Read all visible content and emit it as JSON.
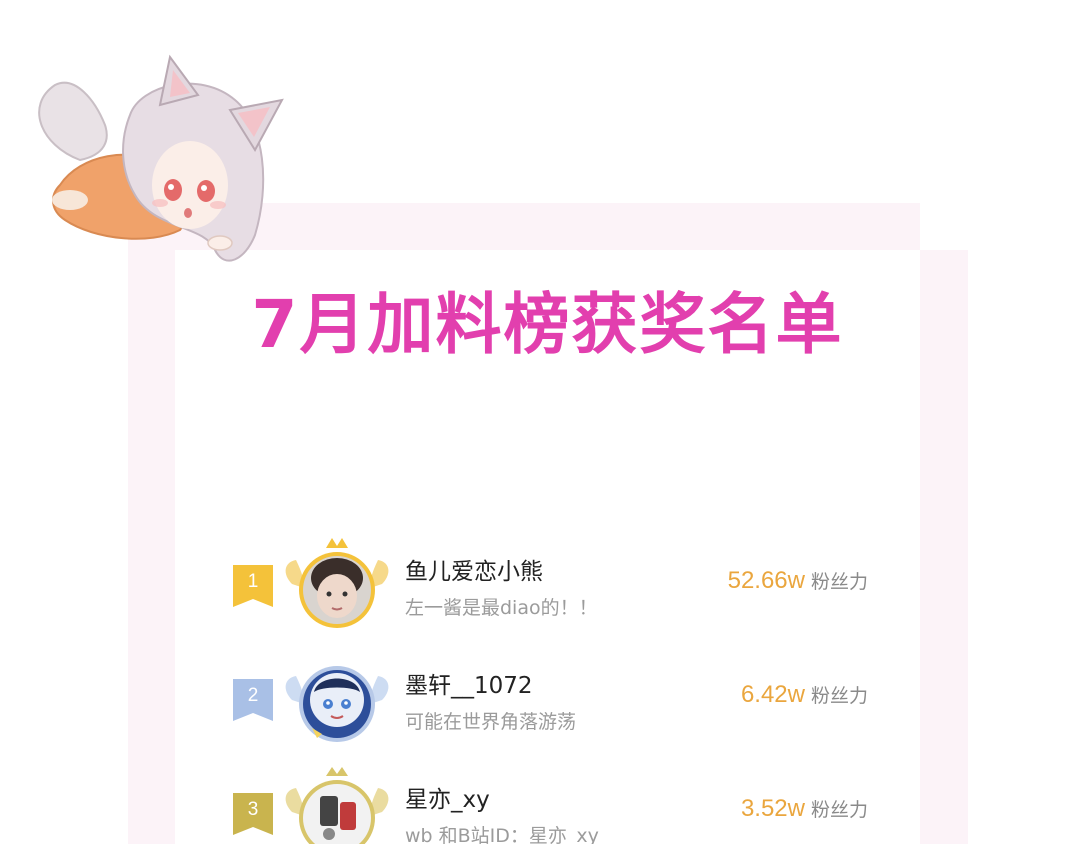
{
  "colors": {
    "title": "#e23fae",
    "score": "#eaa63e",
    "card_back": "#fcf3f8",
    "rank1": "#f4c23a",
    "rank2": "#a9c0e6",
    "rank3": "#c9b44e"
  },
  "mascot": {
    "icon": "fox-girl-mascot-icon"
  },
  "title": "7月加料榜获奖名单",
  "ranking": [
    {
      "rank": "1",
      "name": "鱼儿爱恋小熊",
      "bio": "左一酱是最diao的！！",
      "score": "52.66w",
      "unit": "粉丝力",
      "badge_color": "#f4c23a",
      "frame": "gold-crown-wings-frame-icon"
    },
    {
      "rank": "2",
      "name": "墨轩__1072",
      "bio": "可能在世界角落游荡",
      "score": "6.42w",
      "unit": "粉丝力",
      "badge_color": "#a9c0e6",
      "frame": "silver-wings-frame-icon"
    },
    {
      "rank": "3",
      "name": "星亦_xy",
      "bio": "wb 和B站ID：星亦_xy",
      "score": "3.52w",
      "unit": "粉丝力",
      "badge_color": "#c9b44e",
      "frame": "bronze-wings-frame-icon"
    }
  ]
}
